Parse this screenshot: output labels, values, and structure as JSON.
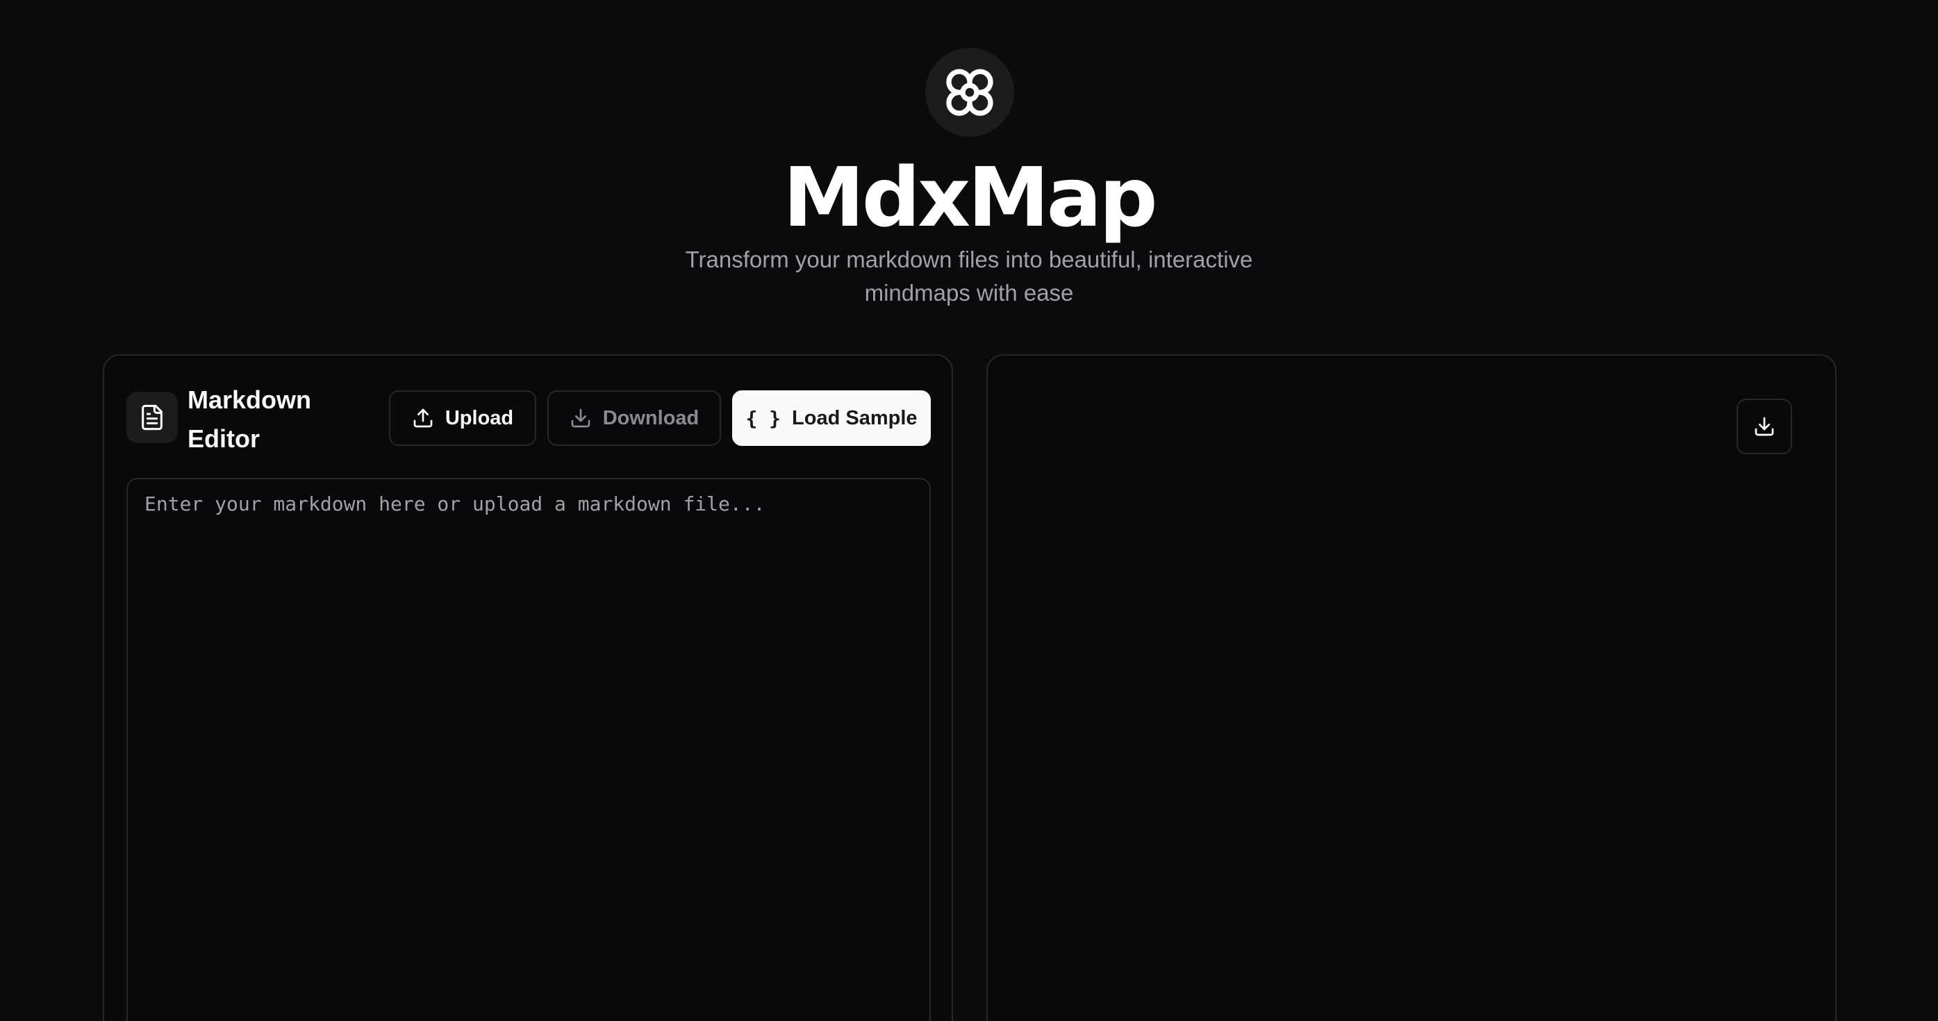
{
  "header": {
    "logo_icon": "flower-gear-icon",
    "title": "MdxMap",
    "subtitle": "Transform your markdown files into beautiful, interactive mindmaps with ease"
  },
  "editor": {
    "icon": "file-text-icon",
    "title": "Markdown Editor",
    "upload_label": "Upload",
    "download_label": "Download",
    "load_sample_label": "Load Sample",
    "load_sample_icon_text": "{ }",
    "placeholder": "Enter your markdown here or upload a markdown file...",
    "value": ""
  },
  "preview": {
    "download_icon": "download-icon"
  },
  "colors": {
    "background": "#0b0b0d",
    "panel_border": "#27272a",
    "muted_text": "#a1a1aa",
    "primary_button_bg": "#fafafa"
  }
}
